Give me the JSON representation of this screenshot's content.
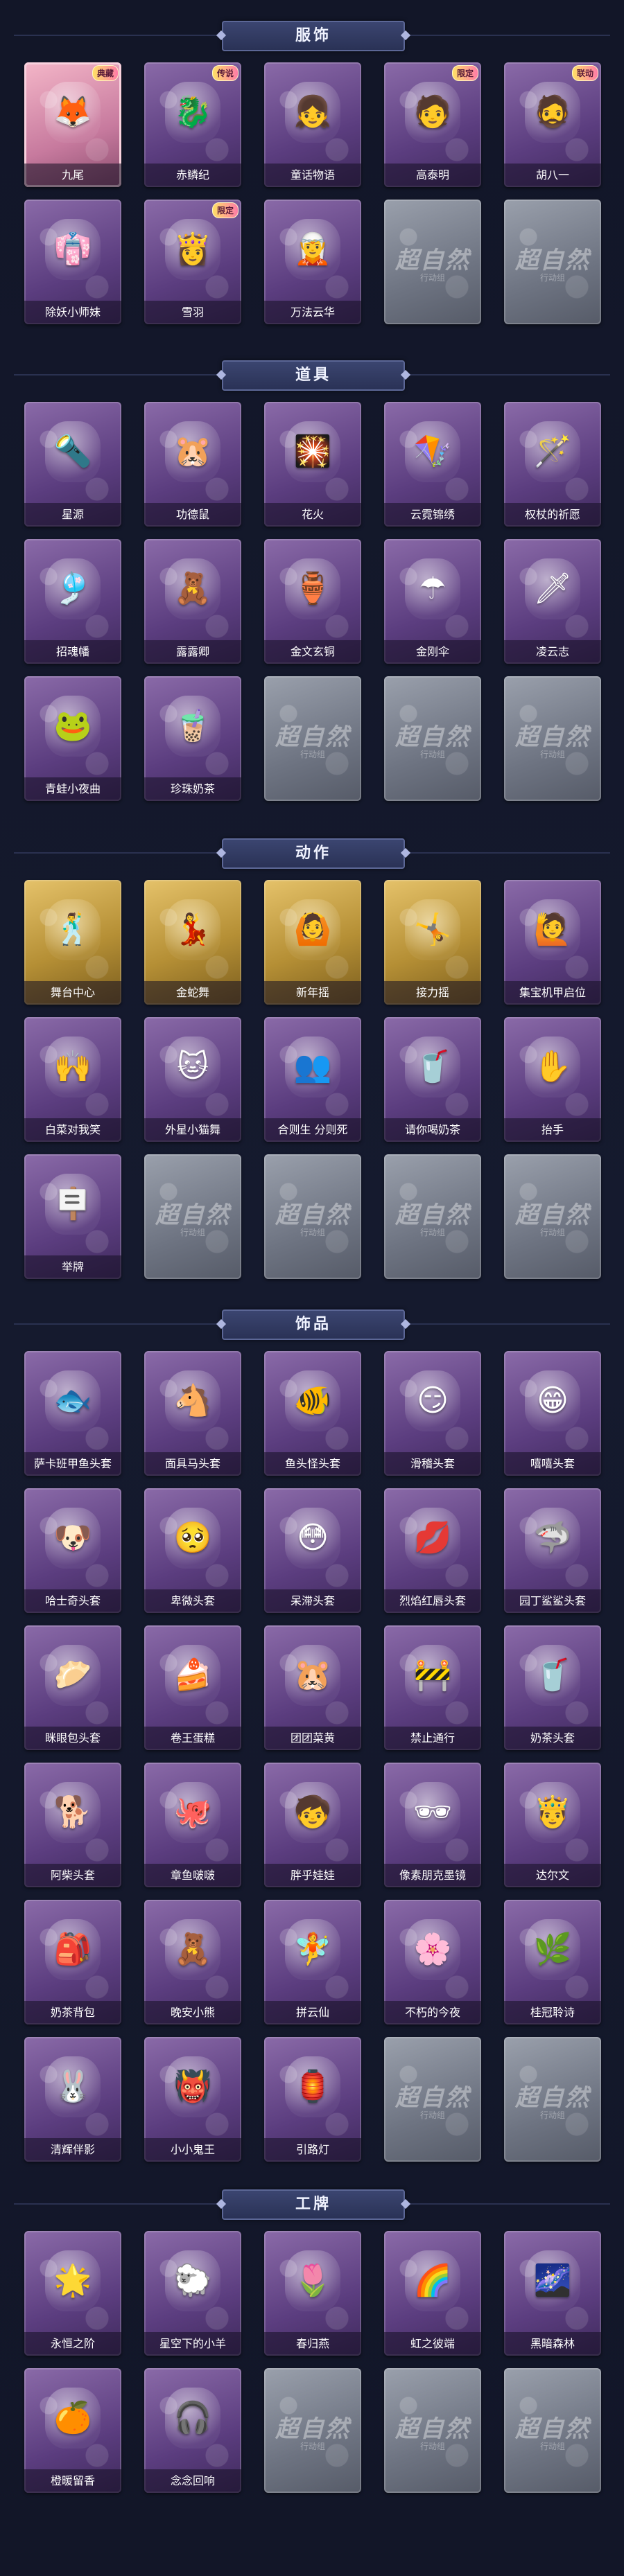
{
  "watermark": {
    "text": "超自然",
    "sub": "行动组"
  },
  "sections": [
    {
      "title": "服饰",
      "items": [
        {
          "label": "九尾",
          "style": "first",
          "icon": "🦊",
          "badge": "典藏"
        },
        {
          "label": "赤鳞纪",
          "style": "normal",
          "icon": "🐉",
          "badge": "传说"
        },
        {
          "label": "童话物语",
          "style": "normal",
          "icon": "👧",
          "badge": ""
        },
        {
          "label": "高泰明",
          "style": "normal",
          "icon": "🧑",
          "badge": "限定"
        },
        {
          "label": "胡八一",
          "style": "normal",
          "icon": "🧔",
          "badge": "联动"
        },
        {
          "label": "除妖小师妹",
          "style": "normal",
          "icon": "👘",
          "badge": ""
        },
        {
          "label": "雪羽",
          "style": "normal",
          "icon": "👸",
          "badge": "限定"
        },
        {
          "label": "万法云华",
          "style": "normal",
          "icon": "🧝",
          "badge": ""
        },
        {
          "label": "",
          "style": "empty",
          "icon": "",
          "badge": ""
        },
        {
          "label": "",
          "style": "empty",
          "icon": "",
          "badge": ""
        }
      ]
    },
    {
      "title": "道具",
      "items": [
        {
          "label": "星源",
          "style": "normal",
          "icon": "🔦",
          "badge": ""
        },
        {
          "label": "功德鼠",
          "style": "normal",
          "icon": "🐹",
          "badge": ""
        },
        {
          "label": "花火",
          "style": "normal",
          "icon": "🎇",
          "badge": ""
        },
        {
          "label": "云霓锦绣",
          "style": "normal",
          "icon": "🪁",
          "badge": ""
        },
        {
          "label": "权杖的祈愿",
          "style": "normal",
          "icon": "🪄",
          "badge": ""
        },
        {
          "label": "招魂幡",
          "style": "normal",
          "icon": "🎐",
          "badge": ""
        },
        {
          "label": "露露卿",
          "style": "normal",
          "icon": "🧸",
          "badge": ""
        },
        {
          "label": "金文玄铜",
          "style": "normal",
          "icon": "🏺",
          "badge": ""
        },
        {
          "label": "金刚伞",
          "style": "normal",
          "icon": "☂",
          "badge": ""
        },
        {
          "label": "凌云志",
          "style": "normal",
          "icon": "🗡",
          "badge": ""
        },
        {
          "label": "青蛙小夜曲",
          "style": "normal",
          "icon": "🐸",
          "badge": ""
        },
        {
          "label": "珍珠奶茶",
          "style": "normal",
          "icon": "🧋",
          "badge": ""
        },
        {
          "label": "",
          "style": "empty",
          "icon": "",
          "badge": ""
        },
        {
          "label": "",
          "style": "empty",
          "icon": "",
          "badge": ""
        },
        {
          "label": "",
          "style": "empty",
          "icon": "",
          "badge": ""
        }
      ]
    },
    {
      "title": "动作",
      "items": [
        {
          "label": "舞台中心",
          "style": "gold",
          "icon": "🕺",
          "badge": ""
        },
        {
          "label": "金蛇舞",
          "style": "gold",
          "icon": "💃",
          "badge": ""
        },
        {
          "label": "新年摇",
          "style": "gold",
          "icon": "🙆",
          "badge": ""
        },
        {
          "label": "接力摇",
          "style": "gold",
          "icon": "🤸",
          "badge": ""
        },
        {
          "label": "集宝机甲启位",
          "style": "normal",
          "icon": "🙋",
          "badge": ""
        },
        {
          "label": "白菜对我笑",
          "style": "normal",
          "icon": "🙌",
          "badge": ""
        },
        {
          "label": "外星小猫舞",
          "style": "normal",
          "icon": "🐱",
          "badge": ""
        },
        {
          "label": "合则生 分则死",
          "style": "normal",
          "icon": "👥",
          "badge": ""
        },
        {
          "label": "请你喝奶茶",
          "style": "normal",
          "icon": "🥤",
          "badge": ""
        },
        {
          "label": "抬手",
          "style": "normal",
          "icon": "✋",
          "badge": ""
        },
        {
          "label": "举牌",
          "style": "normal",
          "icon": "🪧",
          "badge": ""
        },
        {
          "label": "",
          "style": "empty",
          "icon": "",
          "badge": ""
        },
        {
          "label": "",
          "style": "empty",
          "icon": "",
          "badge": ""
        },
        {
          "label": "",
          "style": "empty",
          "icon": "",
          "badge": ""
        },
        {
          "label": "",
          "style": "empty",
          "icon": "",
          "badge": ""
        }
      ]
    },
    {
      "title": "饰品",
      "items": [
        {
          "label": "萨卡班甲鱼头套",
          "style": "normal",
          "icon": "🐟",
          "badge": ""
        },
        {
          "label": "面具马头套",
          "style": "normal",
          "icon": "🐴",
          "badge": ""
        },
        {
          "label": "鱼头怪头套",
          "style": "normal",
          "icon": "🐠",
          "badge": ""
        },
        {
          "label": "滑稽头套",
          "style": "normal",
          "icon": "😏",
          "badge": ""
        },
        {
          "label": "嘻嘻头套",
          "style": "normal",
          "icon": "😁",
          "badge": ""
        },
        {
          "label": "哈士奇头套",
          "style": "normal",
          "icon": "🐶",
          "badge": ""
        },
        {
          "label": "卑微头套",
          "style": "normal",
          "icon": "🥺",
          "badge": ""
        },
        {
          "label": "呆滞头套",
          "style": "normal",
          "icon": "😳",
          "badge": ""
        },
        {
          "label": "烈焰红唇头套",
          "style": "normal",
          "icon": "💋",
          "badge": ""
        },
        {
          "label": "园丁鲨鲨头套",
          "style": "normal",
          "icon": "🦈",
          "badge": ""
        },
        {
          "label": "眯眼包头套",
          "style": "normal",
          "icon": "🥟",
          "badge": ""
        },
        {
          "label": "卷王蛋糕",
          "style": "normal",
          "icon": "🍰",
          "badge": ""
        },
        {
          "label": "团团菜黄",
          "style": "normal",
          "icon": "🐹",
          "badge": ""
        },
        {
          "label": "禁止通行",
          "style": "normal",
          "icon": "🚧",
          "badge": ""
        },
        {
          "label": "奶茶头套",
          "style": "normal",
          "icon": "🥤",
          "badge": ""
        },
        {
          "label": "阿柴头套",
          "style": "normal",
          "icon": "🐕",
          "badge": ""
        },
        {
          "label": "章鱼啵啵",
          "style": "normal",
          "icon": "🐙",
          "badge": ""
        },
        {
          "label": "胖乎娃娃",
          "style": "normal",
          "icon": "🧒",
          "badge": ""
        },
        {
          "label": "像素朋克墨镜",
          "style": "normal",
          "icon": "🕶",
          "badge": ""
        },
        {
          "label": "达尔文",
          "style": "normal",
          "icon": "🤴",
          "badge": ""
        },
        {
          "label": "奶茶背包",
          "style": "normal",
          "icon": "🎒",
          "badge": ""
        },
        {
          "label": "晚安小熊",
          "style": "normal",
          "icon": "🧸",
          "badge": ""
        },
        {
          "label": "拼云仙",
          "style": "normal",
          "icon": "🧚",
          "badge": ""
        },
        {
          "label": "不朽的今夜",
          "style": "normal",
          "icon": "🌸",
          "badge": ""
        },
        {
          "label": "桂冠聆诗",
          "style": "normal",
          "icon": "🌿",
          "badge": ""
        },
        {
          "label": "清辉伴影",
          "style": "normal",
          "icon": "🐰",
          "badge": ""
        },
        {
          "label": "小小鬼王",
          "style": "normal",
          "icon": "👹",
          "badge": ""
        },
        {
          "label": "引路灯",
          "style": "normal",
          "icon": "🏮",
          "badge": ""
        },
        {
          "label": "",
          "style": "empty",
          "icon": "",
          "badge": ""
        },
        {
          "label": "",
          "style": "empty",
          "icon": "",
          "badge": ""
        }
      ]
    },
    {
      "title": "工牌",
      "items": [
        {
          "label": "永恒之阶",
          "style": "normal",
          "icon": "🌟",
          "badge": ""
        },
        {
          "label": "星空下的小羊",
          "style": "normal",
          "icon": "🐑",
          "badge": ""
        },
        {
          "label": "春归燕",
          "style": "normal",
          "icon": "🌷",
          "badge": ""
        },
        {
          "label": "虹之彼端",
          "style": "normal",
          "icon": "🌈",
          "badge": ""
        },
        {
          "label": "黑暗森林",
          "style": "normal",
          "icon": "🌌",
          "badge": ""
        },
        {
          "label": "橙暖留香",
          "style": "normal",
          "icon": "🍊",
          "badge": ""
        },
        {
          "label": "念念回响",
          "style": "normal",
          "icon": "🎧",
          "badge": ""
        },
        {
          "label": "",
          "style": "empty",
          "icon": "",
          "badge": ""
        },
        {
          "label": "",
          "style": "empty",
          "icon": "",
          "badge": ""
        },
        {
          "label": "",
          "style": "empty",
          "icon": "",
          "badge": ""
        }
      ]
    }
  ]
}
